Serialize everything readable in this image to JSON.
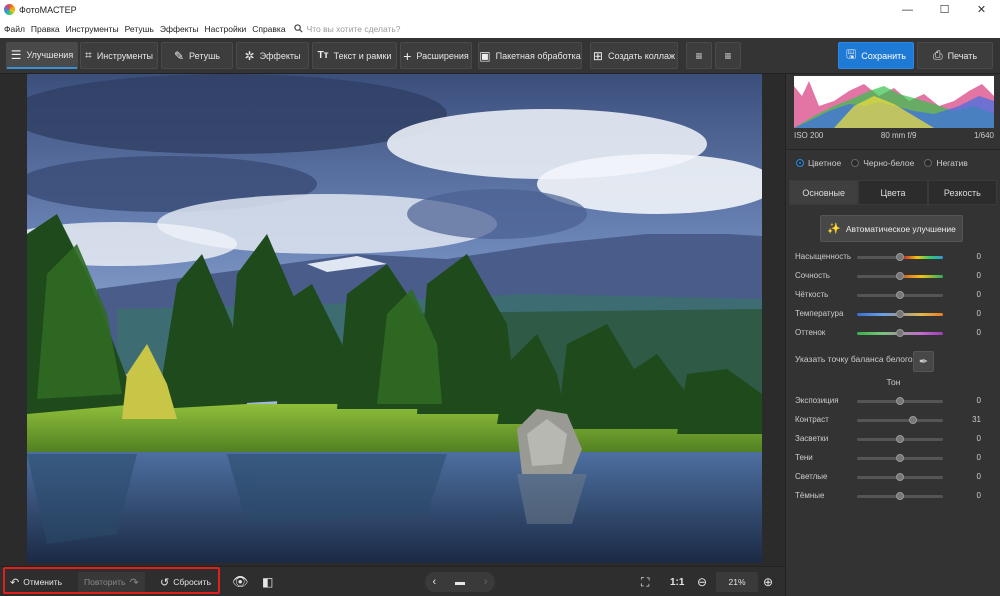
{
  "window": {
    "title": "ФотоМАСТЕР",
    "minimize": "—",
    "maximize": "☐",
    "close": "✕"
  },
  "menu": {
    "items": [
      "Файл",
      "Правка",
      "Инструменты",
      "Ретушь",
      "Эффекты",
      "Настройки",
      "Справка"
    ],
    "search_placeholder": "Что вы хотите сделать?"
  },
  "toolbar": {
    "tabs": [
      {
        "label": "Улучшения",
        "icon": "sliders-icon",
        "active": true
      },
      {
        "label": "Инструменты",
        "icon": "crop-icon"
      },
      {
        "label": "Ретушь",
        "icon": "brush-icon"
      },
      {
        "label": "Эффекты",
        "icon": "magic-wand-icon"
      },
      {
        "label": "Текст и рамки",
        "icon": "text-icon"
      },
      {
        "label": "Расширения",
        "icon": "plus-icon"
      }
    ],
    "batch": "Пакетная обработка",
    "collage": "Создать коллаж",
    "save": "Сохранить",
    "print": "Печать"
  },
  "histogram": {
    "iso": "ISO 200",
    "lens": "80 mm f/9",
    "shutter": "1/640"
  },
  "color_mode": {
    "options": [
      "Цветное",
      "Черно-белое",
      "Негатив"
    ],
    "selected": "Цветное"
  },
  "panel_tabs": [
    {
      "label": "Основные",
      "active": true
    },
    {
      "label": "Цвета"
    },
    {
      "label": "Резкость"
    }
  ],
  "auto_enhance": "Автоматическое улучшение",
  "sliders_top": [
    {
      "label": "Насыщенность",
      "value": "0",
      "level": 0.5
    },
    {
      "label": "Сочность",
      "value": "0",
      "level": 0.5
    },
    {
      "label": "Чёткость",
      "value": "0",
      "level": 0.5
    },
    {
      "label": "Температура",
      "value": "0",
      "level": 0.5
    },
    {
      "label": "Оттенок",
      "value": "0",
      "level": 0.5
    }
  ],
  "white_balance": "Указать точку баланса белого",
  "tone_section": "Тон",
  "sliders_tone": [
    {
      "label": "Экспозиция",
      "value": "0",
      "level": 0.5
    },
    {
      "label": "Контраст",
      "value": "31",
      "level": 0.655
    },
    {
      "label": "Засветки",
      "value": "0",
      "level": 0.5
    },
    {
      "label": "Тени",
      "value": "0",
      "level": 0.5
    },
    {
      "label": "Светлые",
      "value": "0",
      "level": 0.5
    },
    {
      "label": "Тёмные",
      "value": "0",
      "level": 0.5
    }
  ],
  "bottom": {
    "undo": "Отменить",
    "redo": "Повторить",
    "reset": "Сбросить",
    "scale_1to1": "1:1",
    "zoom": "21%"
  },
  "colors": {
    "accent": "#1f7ad6",
    "highlight_frame": "#e0201d"
  }
}
